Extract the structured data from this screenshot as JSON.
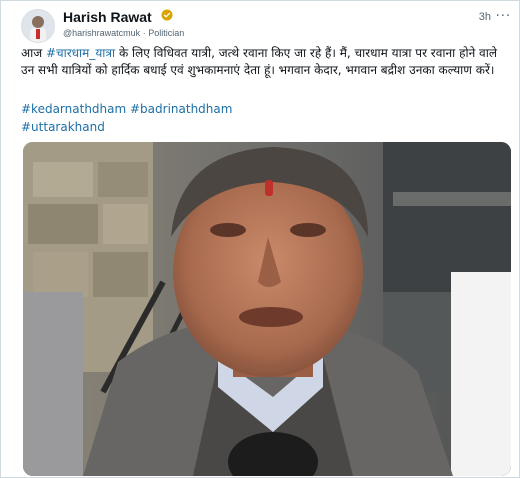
{
  "tweet": {
    "author_name": "Harish Rawat",
    "handle": "@harishrawatcmuk",
    "separator": "·",
    "label": "Politician",
    "time": "3h",
    "more": "···",
    "text_before": "आज ",
    "text_link": "#चारधाम_यात्रा",
    "text_after": " के लिए विधिवत यात्री, जत्थे रवाना किए जा रहे हैं। मैं, चारधाम यात्रा पर रवाना होने वाले उन सभी यात्रियों को हार्दिक बधाई एवं शुभकामनाएं देता हूं। भगवान केदार, भगवान बद्रीश उनका कल्याण करें।",
    "hashtags_line1": "#kedarnathdham #badrinathdham",
    "hashtags_line2": "#uttarakhand"
  },
  "icons": {
    "verified": "verified-badge-icon",
    "more": "more-options-icon"
  },
  "colors": {
    "link": "#1d6fa6",
    "verified_gold": "#d9a400",
    "text": "#0f1419",
    "muted": "#536471"
  }
}
